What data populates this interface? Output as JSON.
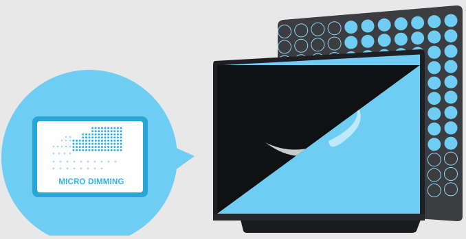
{
  "colors": {
    "background": "#e8e8e8",
    "accent": "#6fcdf4",
    "badge_text": "#30b4e8",
    "led_panel": "#3b3d41",
    "tv_frame": "#1e1f22",
    "moon": "#c9cacc"
  },
  "badge": {
    "icon": "micro-dimming-icon",
    "label": "MICRO DIMMING"
  }
}
